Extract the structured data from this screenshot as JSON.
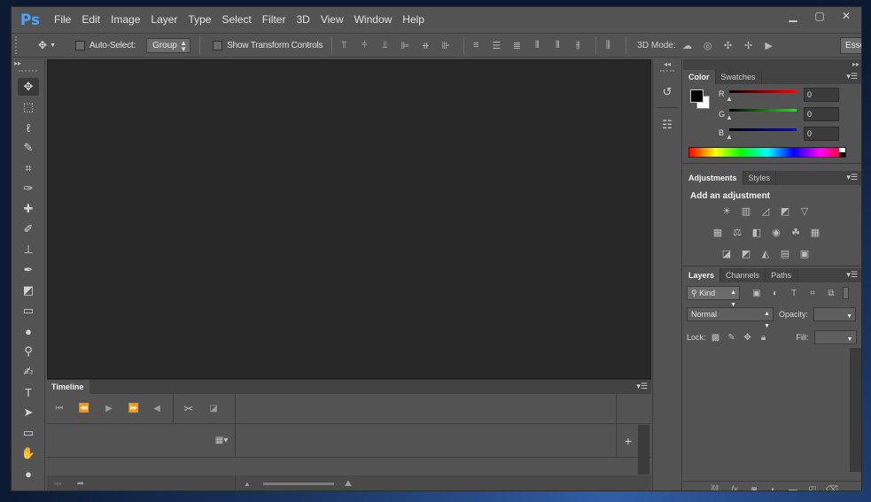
{
  "app": {
    "logo": "Ps",
    "colors": {
      "chrome": "#535353",
      "canvas": "#282828",
      "accent": "#4aa3ff"
    }
  },
  "menubar": {
    "items": [
      "File",
      "Edit",
      "Image",
      "Layer",
      "Type",
      "Select",
      "Filter",
      "3D",
      "View",
      "Window",
      "Help"
    ],
    "window_controls": {
      "minimize": "▁",
      "restore": "▢",
      "close": "✕"
    }
  },
  "options": {
    "tool_preset_icon": "move-tool-icon",
    "auto_select_label": "Auto-Select:",
    "auto_select_value": "Group",
    "show_transform_label": "Show Transform Controls",
    "mode_label": "3D Mode:",
    "essentials_label": "Essentials"
  },
  "toolbar": {
    "tools": [
      "move-tool",
      "marquee-tool",
      "lasso-tool",
      "quick-selection-tool",
      "crop-tool",
      "eyedropper-tool",
      "healing-brush-tool",
      "brush-tool",
      "clone-stamp-tool",
      "history-brush-tool",
      "eraser-tool",
      "gradient-tool",
      "blur-tool",
      "dodge-tool",
      "pen-tool",
      "type-tool",
      "path-selection-tool",
      "rectangle-tool",
      "hand-tool",
      "zoom-tool"
    ]
  },
  "timeline": {
    "tab_label": "Timeline"
  },
  "color_panel": {
    "tabs": [
      "Color",
      "Swatches"
    ],
    "channels": [
      {
        "label": "R",
        "value": "0",
        "color": "#ff0000"
      },
      {
        "label": "G",
        "value": "0",
        "color": "#00ff00"
      },
      {
        "label": "B",
        "value": "0",
        "color": "#0000ff"
      }
    ]
  },
  "adjustments_panel": {
    "tabs": [
      "Adjustments",
      "Styles"
    ],
    "title": "Add an adjustment"
  },
  "layers_panel": {
    "tabs": [
      "Layers",
      "Channels",
      "Paths"
    ],
    "filter_label": "Kind",
    "blend_mode": "Normal",
    "opacity_label": "Opacity:",
    "lock_label": "Lock:",
    "fill_label": "Fill:"
  }
}
